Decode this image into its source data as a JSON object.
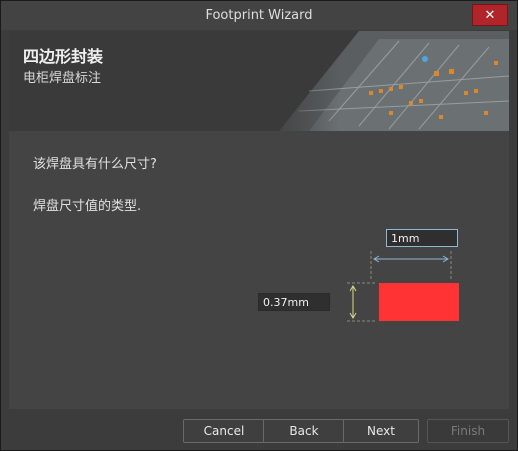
{
  "window": {
    "title": "Footprint Wizard"
  },
  "banner": {
    "title": "四边形封装",
    "subtitle": "电柜焊盘标注"
  },
  "content": {
    "question": "该焊盘具有什么尺寸?",
    "instruction": "焊盘尺寸值的类型."
  },
  "pad": {
    "width_value": "1mm",
    "height_value": "0.37mm",
    "color": "#ff3333"
  },
  "buttons": {
    "cancel": "Cancel",
    "back": "Back",
    "next": "Next",
    "finish": "Finish"
  },
  "colors": {
    "accent": "#b0252a",
    "dimension_line": "#8fb7d6",
    "height_arrow": "#d9d98a"
  }
}
